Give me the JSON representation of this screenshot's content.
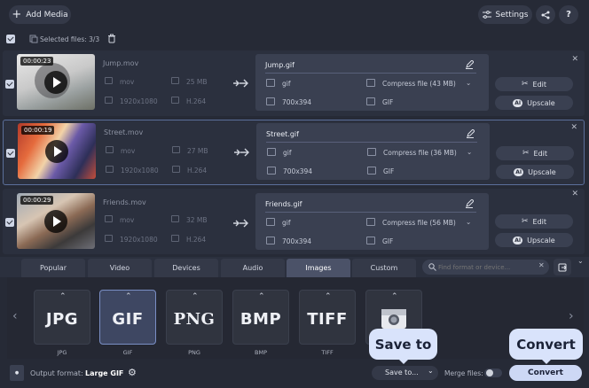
{
  "toolbar": {
    "add_media": "Add Media",
    "settings": "Settings"
  },
  "selection": {
    "text": "Selected files: 3/3"
  },
  "files": [
    {
      "duration": "00:00:23",
      "source_name": "Jump.mov",
      "source_ext": "mov",
      "source_size": "25 MB",
      "source_res": "1920x1080",
      "source_codec": "H.264",
      "output_name": "Jump.gif",
      "output_ext": "gif",
      "compress": "Compress file (43 MB)",
      "output_res": "700x394",
      "output_codec": "GIF",
      "edit": "Edit",
      "upscale": "Upscale"
    },
    {
      "duration": "00:00:19",
      "source_name": "Street.mov",
      "source_ext": "mov",
      "source_size": "27 MB",
      "source_res": "1920x1080",
      "source_codec": "H.264",
      "output_name": "Street.gif",
      "output_ext": "gif",
      "compress": "Compress file (36 MB)",
      "output_res": "700x394",
      "output_codec": "GIF",
      "edit": "Edit",
      "upscale": "Upscale"
    },
    {
      "duration": "00:00:29",
      "source_name": "Friends.mov",
      "source_ext": "mov",
      "source_size": "32 MB",
      "source_res": "1920x1080",
      "source_codec": "H.264",
      "output_name": "Friends.gif",
      "output_ext": "gif",
      "compress": "Compress file (56 MB)",
      "output_res": "700x394",
      "output_codec": "GIF",
      "edit": "Edit",
      "upscale": "Upscale"
    }
  ],
  "tabs": [
    "Popular",
    "Video",
    "Devices",
    "Audio",
    "Images",
    "Custom"
  ],
  "active_tab": "Images",
  "search": {
    "placeholder": "Find format or device..."
  },
  "formats": [
    {
      "big": "JPG",
      "label": "JPG"
    },
    {
      "big": "GIF",
      "label": "GIF"
    },
    {
      "big": "PNG",
      "label": "PNG"
    },
    {
      "big": "BMP",
      "label": "BMP"
    },
    {
      "big": "TIFF",
      "label": "TIFF"
    }
  ],
  "bottom": {
    "output_format_label": "Output format:",
    "output_format_value": "Large GIF",
    "save_to": "Save to...",
    "merge_files": "Merge files:",
    "convert": "Convert"
  },
  "tooltips": {
    "save_to": "Save to",
    "convert": "Convert"
  },
  "colors": {
    "background": "#262a36",
    "selected_accent": "#7a8ec4",
    "convert_button": "#cdd8f5"
  }
}
